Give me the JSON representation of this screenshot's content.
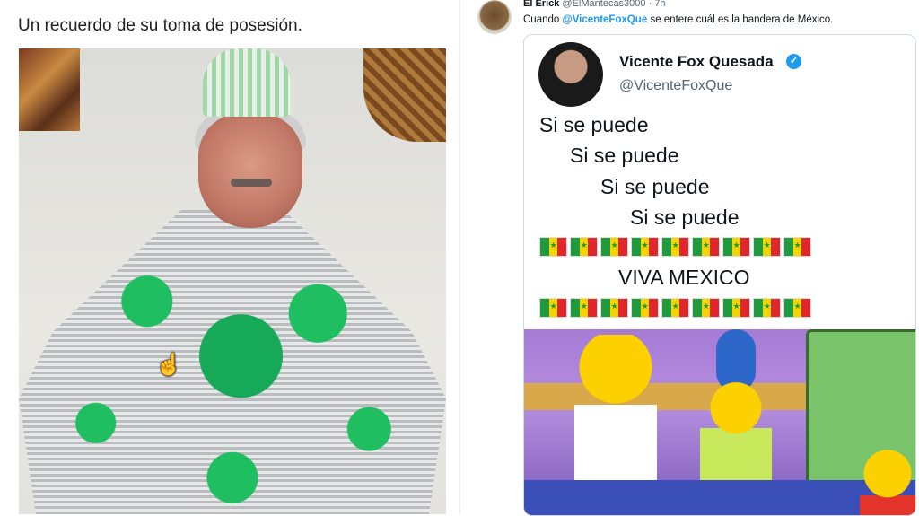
{
  "left_tweet": {
    "caption": "Un recuerdo de su toma de posesión."
  },
  "right_tweet": {
    "author_name": "El Erick",
    "author_handle": "@ElMantecas3000",
    "time_ago": "· 7h",
    "reply_prefix": "Cuando",
    "reply_mention": "@VicenteFoxQue",
    "reply_suffix": "se entere cuál es la bandera de México.",
    "quoted": {
      "name": "Vicente Fox Quesada",
      "handle": "@VicenteFoxQue",
      "lines": [
        "Si se puede",
        "Si se puede",
        "Si se puede",
        "Si se puede"
      ],
      "viva": "VIVA MEXICO",
      "flag_count": 9
    }
  },
  "colors": {
    "mention_blue": "#1d9bf0",
    "verified_blue": "#1d9bf0"
  },
  "icons": [
    "cursor-hand-icon",
    "verified-icon"
  ]
}
